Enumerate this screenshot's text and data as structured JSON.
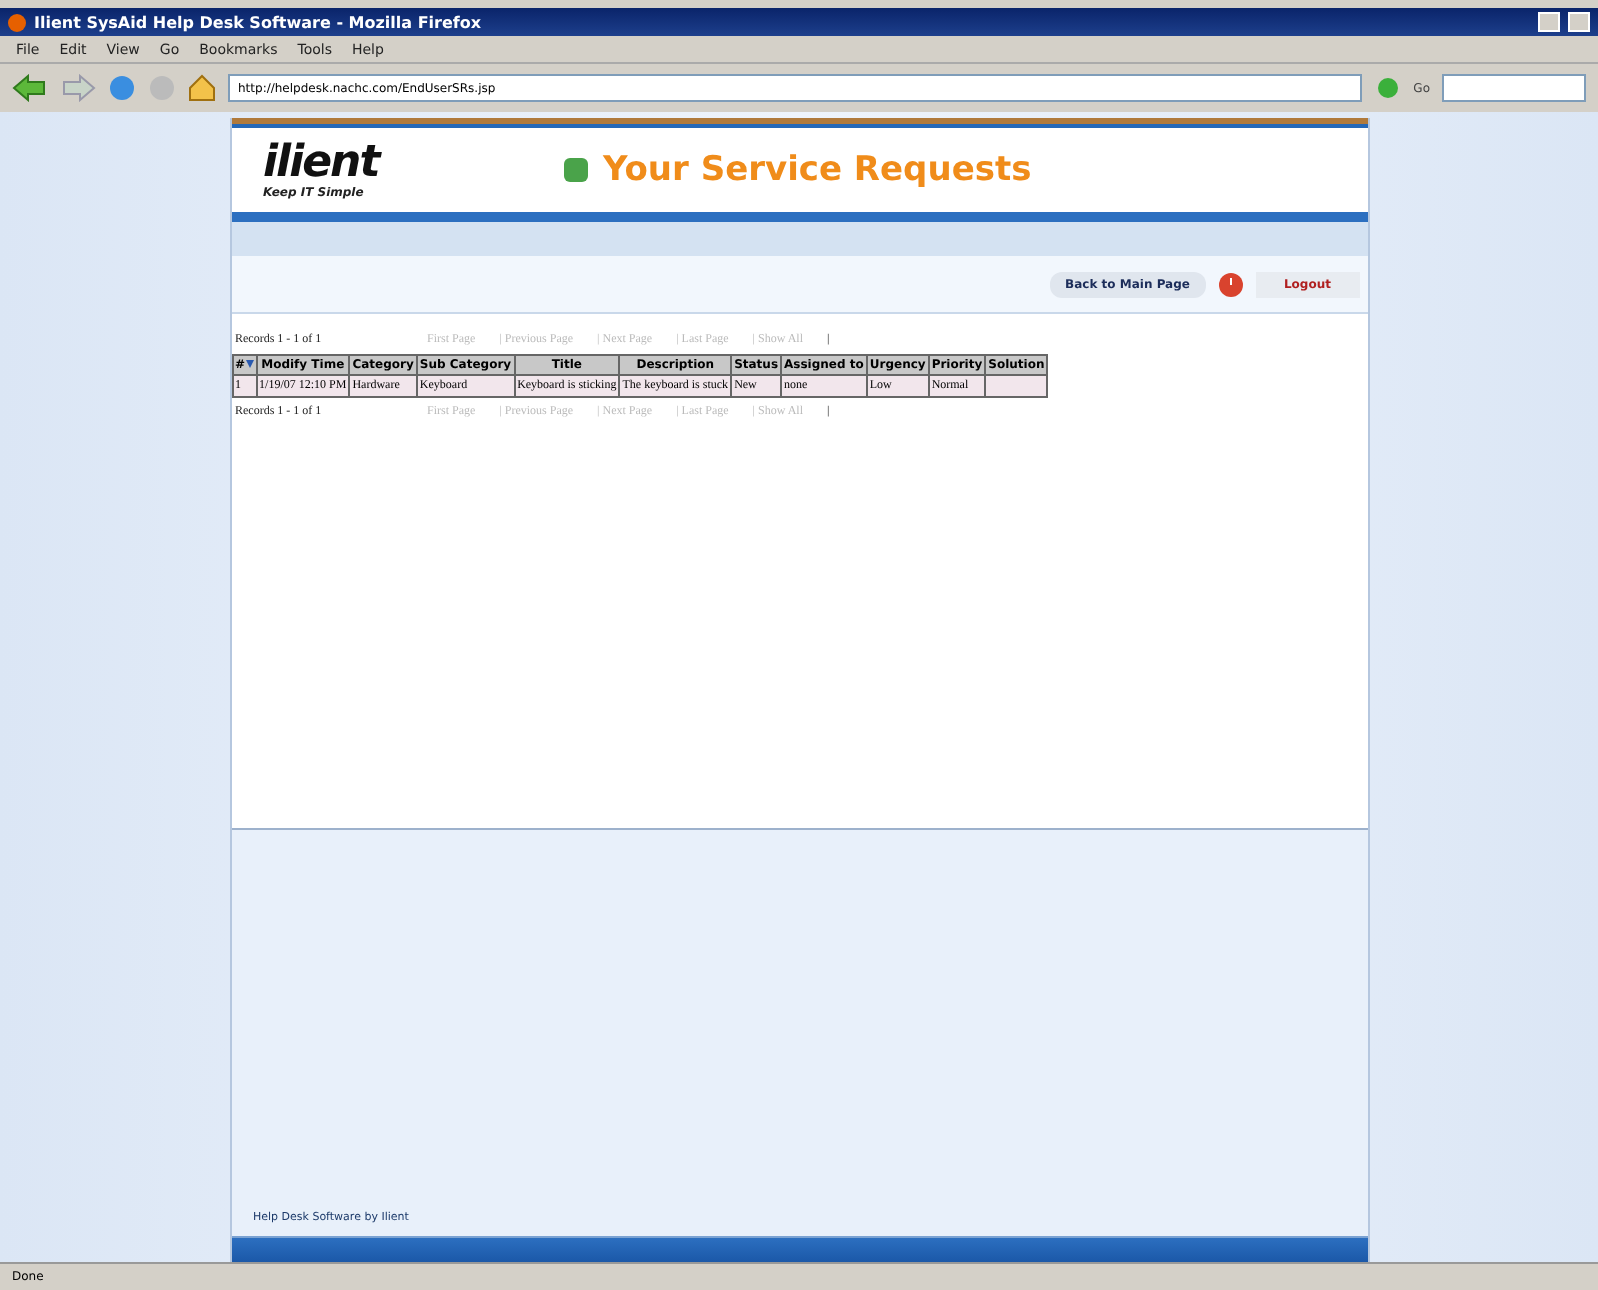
{
  "window": {
    "title": "Ilient SysAid Help Desk Software - Mozilla Firefox"
  },
  "menu": [
    "File",
    "Edit",
    "View",
    "Go",
    "Bookmarks",
    "Tools",
    "Help"
  ],
  "address_bar": {
    "value": "http://helpdesk.nachc.com/EndUserSRs.jsp",
    "go": "Go"
  },
  "header": {
    "logo": "ilient",
    "tagline": "Keep IT Simple",
    "title": "Your Service Requests"
  },
  "actions": {
    "back": "Back to Main Page",
    "logout": "Logout"
  },
  "pager_top": {
    "records": "Records 1 - 1 of 1",
    "links": [
      {
        "label": "First Page",
        "disabled": true
      },
      {
        "label": "| Previous Page",
        "disabled": true
      },
      {
        "label": "| Next Page",
        "disabled": true
      },
      {
        "label": "| Last Page",
        "disabled": true
      },
      {
        "label": "| Show All",
        "disabled": true
      },
      {
        "label": "|",
        "disabled": false
      }
    ]
  },
  "table": {
    "columns": [
      "#",
      "Modify Time",
      "Category",
      "Sub Category",
      "Title",
      "Description",
      "Status",
      "Assigned to",
      "Urgency",
      "Priority",
      "Solution"
    ],
    "rows": [
      [
        "1",
        "1/19/07 12:10 PM",
        "Hardware",
        "Keyboard",
        "Keyboard is sticking",
        "The keyboard is stuck",
        "New",
        "none",
        "Low",
        "Normal",
        ""
      ]
    ]
  },
  "pager_bottom": {
    "records": "Records 1 - 1 of 1",
    "links": [
      {
        "label": "First Page",
        "disabled": true
      },
      {
        "label": "| Previous Page",
        "disabled": true
      },
      {
        "label": "| Next Page",
        "disabled": true
      },
      {
        "label": "| Last Page",
        "disabled": true
      },
      {
        "label": "| Show All",
        "disabled": true
      },
      {
        "label": "|",
        "disabled": false
      }
    ]
  },
  "footer": "Help Desk Software by Ilient",
  "status_bar": "Done"
}
